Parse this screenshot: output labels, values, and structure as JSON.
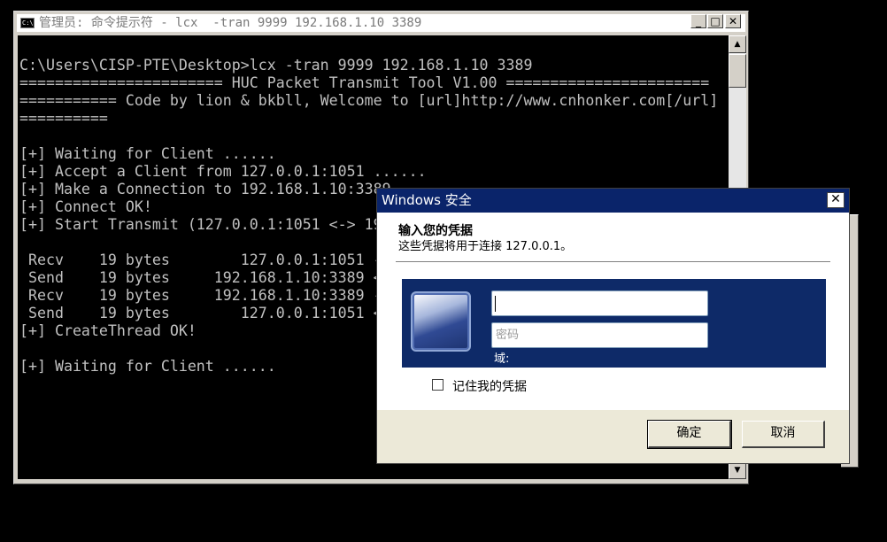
{
  "console_window": {
    "title": "管理员: 命令提示符 - lcx  -tran 9999 192.168.1.10 3389",
    "icon": "cmd-icon",
    "icon_text": "C:\\",
    "buttons": {
      "minimize": "_",
      "maximize": "□",
      "close": "✕"
    },
    "lines": [
      "C:\\Users\\CISP-PTE\\Desktop>lcx -tran 9999 192.168.1.10 3389",
      "======================= HUC Packet Transmit Tool V1.00 =======================",
      "=========== Code by lion & bkbll, Welcome to [url]http://www.cnhonker.com[/url]",
      "==========",
      "",
      "[+] Waiting for Client ......",
      "[+] Accept a Client from 127.0.0.1:1051 ......",
      "[+] Make a Connection to 192.168.1.10:3389......",
      "[+] Connect OK!",
      "[+] Start Transmit (127.0.0.1:1051 <-> 192.168.1.10:3389) ......",
      "",
      " Recv    19 bytes        127.0.0.1:1051 -> 192.168.1.10:3389",
      " Send    19 bytes     192.168.1.10:3389 <- 127.0.0.1:1051",
      " Recv    19 bytes     192.168.1.10:3389 -> 127.0.0.1:1051",
      " Send    19 bytes        127.0.0.1:1051 <- 192.168.1.10:3389",
      "[+] CreateThread OK!",
      "",
      "[+] Waiting for Client ......"
    ],
    "scroll_up": "▲",
    "scroll_down": "▼"
  },
  "security_dialog": {
    "title": "Windows 安全",
    "close": "✕",
    "heading": "输入您的凭据",
    "subtitle": "这些凭据将用于连接 127.0.0.1。",
    "username_value": "",
    "password_placeholder": "密码",
    "domain_label": "域:",
    "remember_label": "记住我的凭据",
    "remember_checked": false,
    "ok_label": "确定",
    "cancel_label": "取消"
  },
  "colors": {
    "console_bg": "#000000",
    "console_text": "#c0c0c0",
    "dialog_title_bg": "#0a246a",
    "credential_panel_bg": "#0e2a68"
  }
}
